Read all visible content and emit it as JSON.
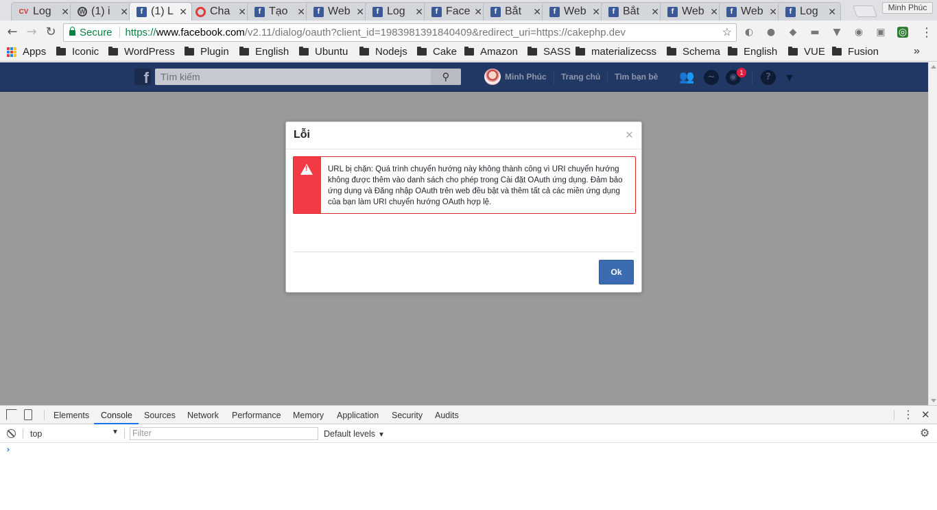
{
  "browser": {
    "tabs": [
      {
        "label": "Log",
        "favicon": "cv-icon"
      },
      {
        "label": "(1) i",
        "favicon": "wordpress-icon"
      },
      {
        "label": "(1) L",
        "favicon": "facebook-icon",
        "active": true
      },
      {
        "label": "Cha",
        "favicon": "chat-icon"
      },
      {
        "label": "Tạo",
        "favicon": "facebook-icon"
      },
      {
        "label": "Web",
        "favicon": "facebook-icon"
      },
      {
        "label": "Log",
        "favicon": "facebook-icon"
      },
      {
        "label": "Face",
        "favicon": "facebook-icon"
      },
      {
        "label": "Bắt",
        "favicon": "facebook-icon"
      },
      {
        "label": "Web",
        "favicon": "facebook-icon"
      },
      {
        "label": "Bắt",
        "favicon": "facebook-icon"
      },
      {
        "label": "Web",
        "favicon": "facebook-icon"
      },
      {
        "label": "Web",
        "favicon": "facebook-icon"
      },
      {
        "label": "Log",
        "favicon": "facebook-icon"
      }
    ],
    "profile_name": "Minh Phúc",
    "address": {
      "secure_label": "Secure",
      "scheme": "https://",
      "host": "www.facebook.com",
      "path": "/v2.11/dialog/oauth?client_id=1983981391840409&redirect_uri=https://cakephp.dev"
    },
    "bookmarks": [
      "Apps",
      "Iconic",
      "WordPress",
      "Plugin",
      "English",
      "Ubuntu",
      "Nodejs",
      "Cake",
      "Amazon",
      "SASS",
      "materializecss",
      "Schema",
      "English",
      "VUE",
      "Fusion"
    ],
    "bookmarks_more": "»"
  },
  "facebook": {
    "logo": "f",
    "search_placeholder": "Tìm kiếm",
    "user_name": "Minh Phúc",
    "nav_home": "Trang chủ",
    "nav_find_friends": "Tìm bạn bè",
    "notification_count": "1"
  },
  "dialog": {
    "title": "Lỗi",
    "close": "×",
    "message": "URL bị chặn: Quá trình chuyển hướng này không thành công vì URI chuyển hướng không được thêm vào danh sách cho phép trong Cài đặt OAuth ứng dụng. Đảm bảo ứng dụng và Đăng nhập OAuth trên web đều bật và thêm tất cả các miền ứng dụng của bạn làm URI chuyển hướng OAuth hợp lệ.",
    "ok_label": "Ok"
  },
  "devtools": {
    "tabs": [
      "Elements",
      "Console",
      "Sources",
      "Network",
      "Performance",
      "Memory",
      "Application",
      "Security",
      "Audits"
    ],
    "active_tab": "Console",
    "context": "top",
    "filter_placeholder": "Filter",
    "levels": "Default levels",
    "prompt": "›"
  },
  "colors": {
    "facebook_blue": "#3b5998",
    "fb_bar": "#223864",
    "alert_red": "#f33b45",
    "ok_button": "#3b6bb0",
    "secure_green": "#0b8043"
  }
}
